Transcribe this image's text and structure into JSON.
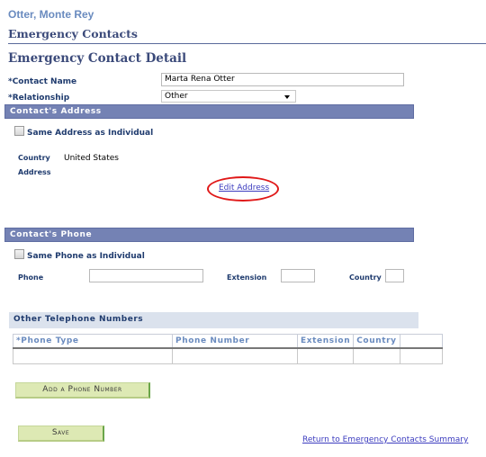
{
  "header": {
    "person_name": "Otter, Monte Rey",
    "section_title": "Emergency Contacts",
    "page_title": "Emergency Contact Detail"
  },
  "contact": {
    "name_label": "*Contact Name",
    "name_value": "Marta Rena Otter",
    "relationship_label": "*Relationship",
    "relationship_value": "Other"
  },
  "address_section": {
    "title": "Contact's Address",
    "same_address_label": "Same Address as Individual",
    "same_address_checked": false,
    "country_label": "Country",
    "country_value": "United States",
    "address_label": "Address",
    "edit_address_link": "Edit Address",
    "highlight_color": "#e01818"
  },
  "phone_section": {
    "title": "Contact's Phone",
    "same_phone_label": "Same Phone as Individual",
    "same_phone_checked": false,
    "phone_label": "Phone",
    "phone_value": "",
    "extension_label": "Extension",
    "extension_value": "",
    "country_label": "Country",
    "country_value": ""
  },
  "other_numbers": {
    "title": "Other Telephone Numbers",
    "columns": [
      "*Phone Type",
      "Phone Number",
      "Extension",
      "Country",
      ""
    ],
    "rows": [
      [
        "",
        "",
        "",
        "",
        ""
      ]
    ]
  },
  "buttons": {
    "add_phone": "Add a Phone Number",
    "save": "Save"
  },
  "links": {
    "return_summary": "Return to Emergency Contacts Summary"
  },
  "colors": {
    "section_bar": "#7482b4",
    "light_bar": "#dbe2ed",
    "button_bg": "#dde9b4",
    "link": "#3c3cbf"
  }
}
